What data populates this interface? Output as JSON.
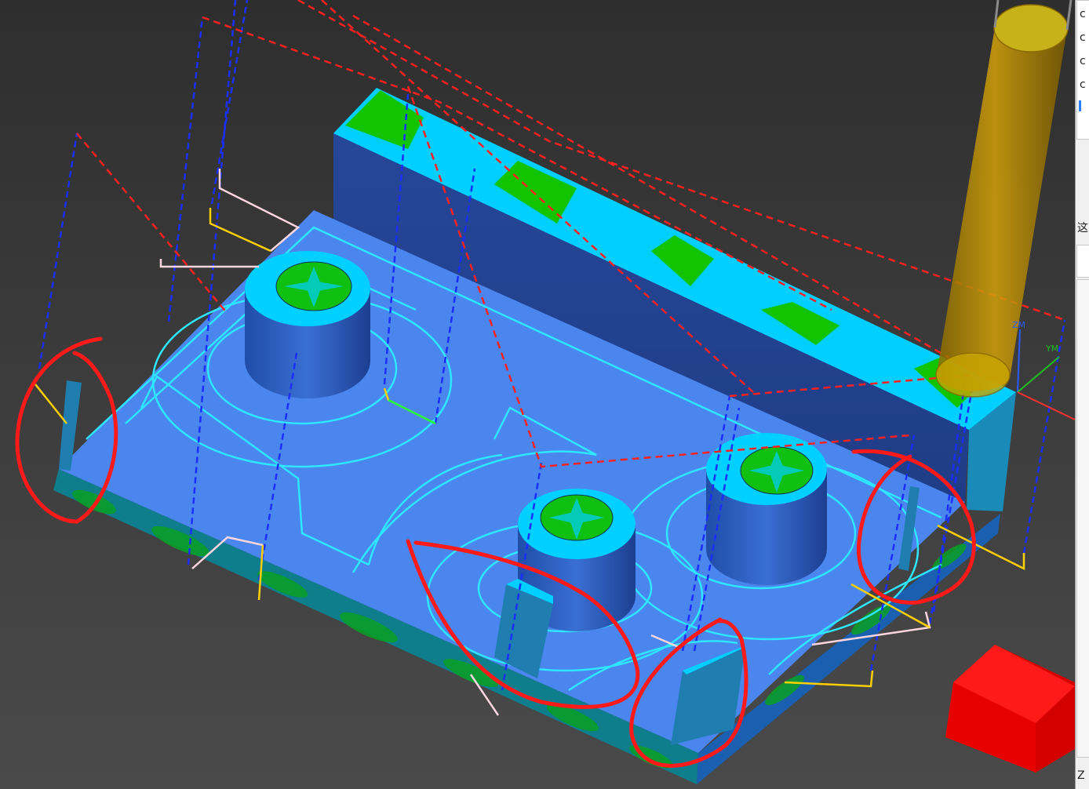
{
  "viewport": {
    "background_color": "#3b3b3b",
    "colors": {
      "base_top": "#4a8af0",
      "base_side": "#0f7a8a",
      "wall_face": "#23438e",
      "wall_top": "#00d0ff",
      "gouge_green": "#00c000",
      "toolpath_cyan": "#2ee6ff",
      "rapid_blue_dashed": "#1a2fff",
      "rapid_red_dashed": "#ff2020",
      "link_yellow": "#ffd000",
      "link_pink": "#ffd6e0",
      "cutter_holder": "#c89a00",
      "stock_marker_red": "#ff1010",
      "annotation_circle_red": "#ff1a1a"
    },
    "axis_triad": {
      "z_label": "ZM",
      "y_label": "YM"
    },
    "icons": [
      "cutter-tool-icon",
      "coordinate-triad-icon",
      "stock-marker-icon"
    ]
  },
  "right_panel": {
    "lines": [
      "c",
      "c",
      "c",
      "c"
    ],
    "mid_char": "这",
    "bottom_char": "Z"
  }
}
